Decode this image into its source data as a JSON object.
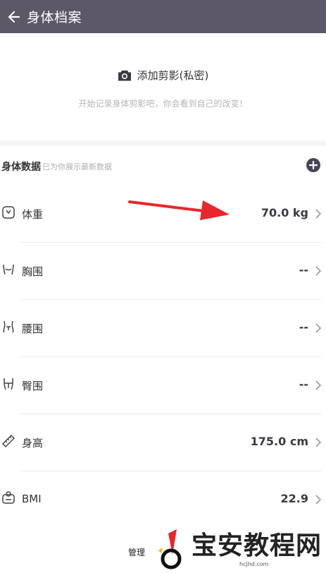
{
  "topbar": {
    "title": "身体档案",
    "back_icon": "arrow-left-icon"
  },
  "photo": {
    "add_label": "添加剪影(私密)",
    "hint": "开始记录身体剪影吧，你会看到自己的改变！",
    "icon": "camera-icon"
  },
  "body_data": {
    "title": "身体数据",
    "subtitle": "已为你展示最新数据",
    "rows": [
      {
        "label": "体重",
        "value": "70.0 kg",
        "icon": "scale-icon"
      },
      {
        "label": "胸围",
        "value": "--",
        "icon": "chest-icon"
      },
      {
        "label": "腰围",
        "value": "--",
        "icon": "waist-icon"
      },
      {
        "label": "臀围",
        "value": "--",
        "icon": "hip-icon"
      },
      {
        "label": "身高",
        "value": "175.0 cm",
        "icon": "ruler-icon"
      },
      {
        "label": "BMI",
        "value": "22.9",
        "icon": "bmi-icon"
      }
    ]
  },
  "footer": {
    "manage_label": "管理"
  },
  "watermark": {
    "name": "宝安教程网",
    "url": "hcjhd.com"
  },
  "colors": {
    "topbar": "#5d5868",
    "annotation_arrow": "#e8262b"
  }
}
